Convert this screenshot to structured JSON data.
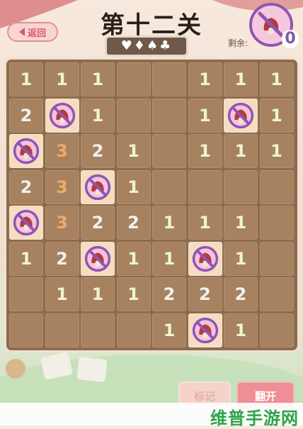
{
  "header": {
    "back_label": "返回",
    "level_title": "第十二关",
    "suits": "♥♦♠♣",
    "remaining_label": "剩余:",
    "remaining_count": "0"
  },
  "board": {
    "rows": 8,
    "cols": 8,
    "cells": [
      [
        "1",
        "1",
        "1",
        "",
        "",
        "1",
        "1",
        "1"
      ],
      [
        "2",
        "F",
        "1",
        "",
        "",
        "1",
        "F",
        "1"
      ],
      [
        "F",
        "3",
        "2",
        "1",
        "",
        "1",
        "1",
        "1"
      ],
      [
        "2",
        "3",
        "F",
        "1",
        "",
        "",
        "",
        ""
      ],
      [
        "F",
        "3",
        "2",
        "2",
        "1",
        "1",
        "1",
        ""
      ],
      [
        "1",
        "2",
        "F",
        "1",
        "1",
        "F",
        "1",
        ""
      ],
      [
        "",
        "1",
        "1",
        "1",
        "2",
        "2",
        "2",
        ""
      ],
      [
        "",
        "",
        "",
        "",
        "1",
        "F",
        "1",
        ""
      ]
    ],
    "flag_icon": "no-mushroom-icon"
  },
  "buttons": {
    "mark_label": "标记",
    "flip_label": "翻开"
  },
  "watermark": "维普手游网",
  "colors": {
    "board": "#8c6b4f",
    "cell": "#a68261",
    "flag_cell": "#f6dcc0",
    "flag_ring": "#8f55b3",
    "number_three": "#f0a96a",
    "accent_pink": "#ef8e95"
  }
}
